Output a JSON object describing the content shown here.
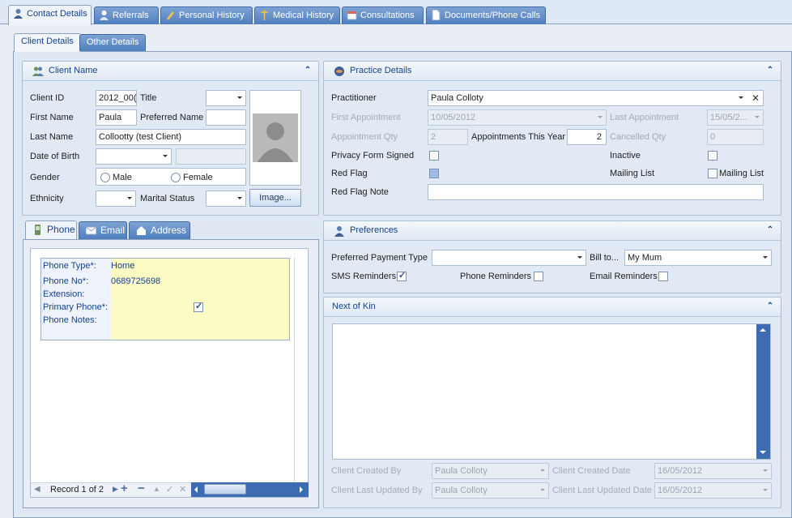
{
  "top_tabs": [
    {
      "label": "Contact Details"
    },
    {
      "label": "Referrals"
    },
    {
      "label": "Personal History"
    },
    {
      "label": "Medical History"
    },
    {
      "label": "Consultations"
    },
    {
      "label": "Documents/Phone Calls"
    }
  ],
  "sub_tabs": [
    {
      "label": "Client Details"
    },
    {
      "label": "Other Details"
    }
  ],
  "client_name": {
    "title": "Client Name",
    "client_id_label": "Client ID",
    "client_id_value": "2012_00(",
    "title_label": "Title",
    "title_value": "",
    "first_name_label": "First Name",
    "first_name_value": "Paula",
    "preferred_name_label": "Preferred Name",
    "preferred_name_value": "",
    "last_name_label": "Last Name",
    "last_name_value": "Collootty (test Client)",
    "dob_label": "Date of Birth",
    "dob_value": "",
    "gender_label": "Gender",
    "male_label": "Male",
    "female_label": "Female",
    "ethnicity_label": "Ethnicity",
    "ethnicity_value": "",
    "marital_label": "Marital Status",
    "marital_value": "",
    "image_button": "Image..."
  },
  "phone_tabs": [
    {
      "label": "Phone"
    },
    {
      "label": "Email"
    },
    {
      "label": "Address"
    }
  ],
  "phone_record": {
    "type_label": "Phone Type*:",
    "type_value": "Home",
    "no_label": "Phone No*:",
    "no_value": "0689725698",
    "ext_label": "Extension:",
    "ext_value": "",
    "primary_label": "Primary Phone*:",
    "primary_checked": true,
    "notes_label": "Phone Notes:",
    "notes_value": ""
  },
  "navigator": {
    "record_text": "Record 1 of 2"
  },
  "practice": {
    "title": "Practice Details",
    "practitioner_label": "Practitioner",
    "practitioner_value": "Paula Colloty",
    "first_appt_label": "First Appointment",
    "first_appt_value": "10/05/2012",
    "last_appt_label": "Last Appointment",
    "last_appt_value": "15/05/2...",
    "appt_qty_label": "Appointment Qty",
    "appt_qty_value": "2",
    "appt_year_label": "Appointments This Year",
    "appt_year_value": "2",
    "cancelled_label": "Cancelled Qty",
    "cancelled_value": "0",
    "privacy_label": "Privacy Form Signed",
    "inactive_label": "Inactive",
    "red_flag_label": "Red Flag",
    "mailing_list_label": "Mailing List",
    "mailing_list_check_label": "Mailing List",
    "red_flag_note_label": "Red Flag Note",
    "red_flag_note_value": ""
  },
  "preferences": {
    "title": "Preferences",
    "payment_label": "Preferred Payment Type",
    "payment_value": "",
    "bill_to_label": "Bill to...",
    "bill_to_value": "My Mum",
    "sms_label": "SMS Reminders",
    "sms_checked": true,
    "phone_rem_label": "Phone Reminders",
    "email_rem_label": "Email Reminders"
  },
  "next_of_kin": {
    "title": "Next of Kin"
  },
  "audit": {
    "created_by_label": "Client Created By",
    "created_by_value": "Paula Colloty",
    "created_date_label": "Client Created Date",
    "created_date_value": "16/05/2012",
    "updated_by_label": "Client Last Updated By",
    "updated_by_value": "Paula Colloty",
    "updated_date_label": "Client Last Updated Date",
    "updated_date_value": "16/05/2012"
  },
  "colors": {
    "accent": "#15428b",
    "tab_blue": "#4f7fbf",
    "note_yellow": "#fdfbc4"
  }
}
